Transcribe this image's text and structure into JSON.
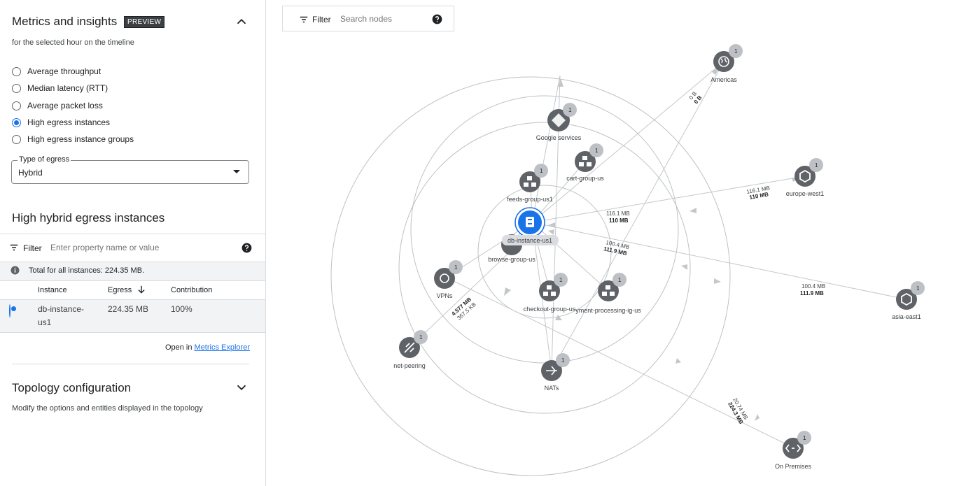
{
  "panel": {
    "title": "Metrics and insights",
    "badge": "PREVIEW",
    "subtitle": "for the selected hour on the timeline",
    "options": [
      {
        "label": "Average throughput",
        "selected": false
      },
      {
        "label": "Median latency (RTT)",
        "selected": false
      },
      {
        "label": "Average packet loss",
        "selected": false
      },
      {
        "label": "High egress instances",
        "selected": true
      },
      {
        "label": "High egress instance groups",
        "selected": false
      }
    ],
    "egress_type": {
      "label": "Type of egress",
      "value": "Hybrid"
    },
    "section_title": "High hybrid egress instances",
    "filter": {
      "label": "Filter",
      "placeholder": "Enter property name or value"
    },
    "total": "Total for all instances: 224.35 MB.",
    "table": {
      "headers": {
        "instance": "Instance",
        "egress": "Egress",
        "contribution": "Contribution"
      },
      "rows": [
        {
          "instance_line1": "db-instance-",
          "instance_line2": "us1",
          "egress": "224.35 MB",
          "contribution": "100%",
          "selected": true
        }
      ]
    },
    "open_in": "Open in",
    "metrics_explorer": "Metrics Explorer",
    "topology_title": "Topology configuration",
    "topology_sub": "Modify the options and entities displayed in the topology"
  },
  "topo_filter": {
    "label": "Filter",
    "placeholder": "Search nodes"
  },
  "nodes": {
    "db": "db-instance-us1",
    "google": "Google services",
    "cart": "cart-group-us",
    "feeds": "feeds-group-us1",
    "browse": "browse-group-us",
    "vpns": "VPNs",
    "checkout": "checkout-group-us",
    "payment": "yment-processing-ig-us",
    "nats": "NATs",
    "netpeering": "net-peering",
    "americas": "Americas",
    "europe": "europe-west1",
    "asia": "asia-east1",
    "onprem": "On Premises",
    "count": "1"
  },
  "edges": {
    "americas_a": "0 B",
    "americas_b": "0 B",
    "europe_a": "116.1 MB",
    "europe_b": "110 MB",
    "inner_a": "116.1 MB",
    "inner_b": "110 MB",
    "asia_inner_a": "100.4 MB",
    "asia_inner_b": "111.9 MB",
    "asia_a": "100.4 MB",
    "asia_b": "111.9 MB",
    "onprem_a": "20.74 MB",
    "onprem_b": "224.3 MB",
    "peer_a": "4.577 MB",
    "peer_b": "367.5 KB"
  },
  "colors": {
    "accent": "#1a73e8",
    "node": "#5f6368",
    "ring": "#bdc1c6"
  }
}
